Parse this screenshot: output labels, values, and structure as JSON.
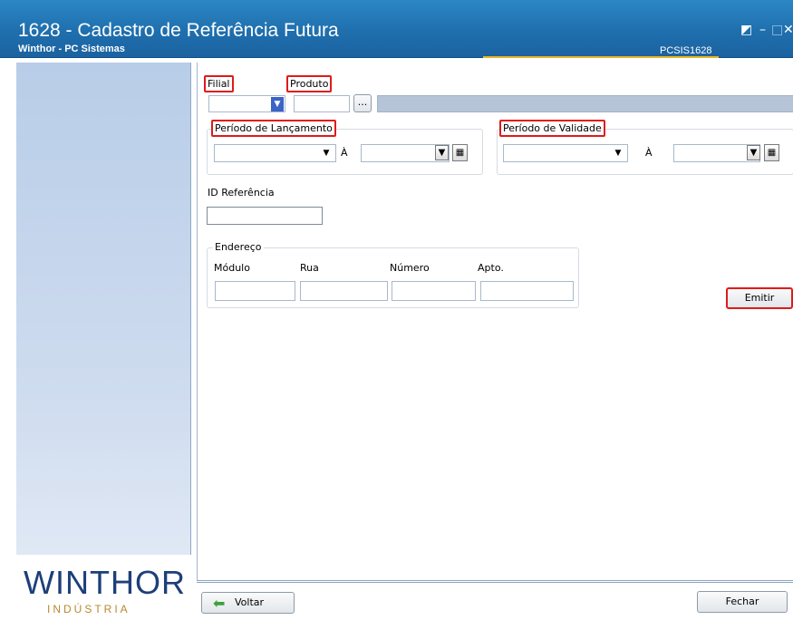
{
  "window": {
    "title": "1628 - Cadastro de Referência Futura",
    "subtitle": "Winthor - PC Sistemas",
    "code": "PCSIS1628"
  },
  "sidebar": {
    "brand": "WINTHOR",
    "tagline": "INDÚSTRIA"
  },
  "form": {
    "filial_label": "Filial",
    "produto_label": "Produto",
    "browse_label": "...",
    "periodo_lancamento_label": "Período de Lançamento",
    "periodo_validade_label": "Período de Validade",
    "ate_label": "À",
    "id_referencia_label": "ID Referência",
    "endereco_label": "Endereço",
    "modulo_label": "Módulo",
    "rua_label": "Rua",
    "numero_label": "Número",
    "apto_label": "Apto."
  },
  "buttons": {
    "emitir": "Emitir",
    "voltar": "Voltar",
    "fechar": "Fechar"
  },
  "colors": {
    "title_bar": "#1f6fae",
    "highlight": "#e01a1a",
    "accent": "#e7b625"
  }
}
